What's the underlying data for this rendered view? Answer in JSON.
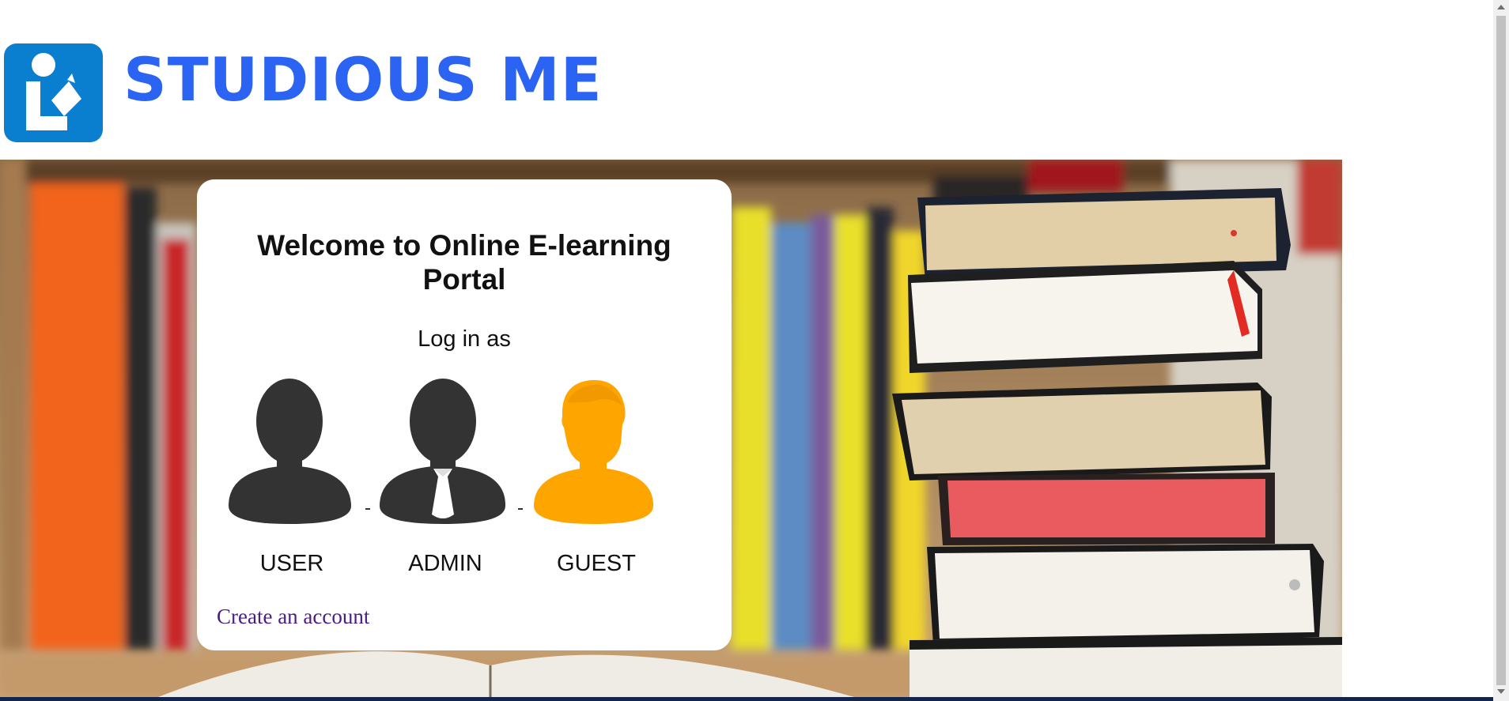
{
  "brand": {
    "name": "STUDIOUS ME",
    "logo_icon": "library-reader-icon",
    "color": "#2b63f2"
  },
  "card": {
    "title": "Welcome to Online E-learning Portal",
    "subtitle": "Log in as",
    "roles": [
      {
        "label": "USER",
        "icon": "user-avatar-icon",
        "color": "#333333"
      },
      {
        "label": "ADMIN",
        "icon": "admin-avatar-icon",
        "color": "#333333"
      },
      {
        "label": "GUEST",
        "icon": "guest-avatar-icon",
        "color": "#ffa500"
      }
    ],
    "create_account": "Create an account"
  },
  "hero": {
    "image": "bookshelf-with-stacked-books"
  }
}
